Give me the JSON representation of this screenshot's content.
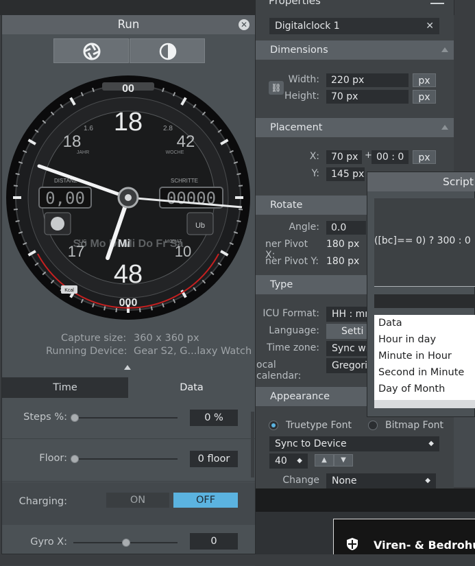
{
  "properties": {
    "title": "Properties",
    "name_value": "Digitalclock 1",
    "dimensions": {
      "header": "Dimensions",
      "width_label": "Width:",
      "width_value": "220 px",
      "height_label": "Height:",
      "height_value": "70 px",
      "unit": "px"
    },
    "placement": {
      "header": "Placement",
      "x_label": "X:",
      "x_value": "70 px",
      "x_offset": "00 : 0",
      "y_label": "Y:",
      "y_value": "145 px",
      "unit": "px",
      "plus": "+"
    },
    "rotate": {
      "header": "Rotate",
      "angle_label": "Angle:",
      "angle_value": "0.0",
      "pivot_x_label": "ner Pivot X:",
      "pivot_x_value": "180 px",
      "pivot_y_label": "ner Pivot Y:",
      "pivot_y_value": "180 px"
    },
    "type": {
      "header": "Type",
      "icu_label": "ICU Format:",
      "icu_value": "HH : mr",
      "language_label": "Language:",
      "language_value": "Setti",
      "timezone_label": "Time zone:",
      "timezone_value": "Sync wi",
      "calendar_label": "ocal calendar:",
      "calendar_value": "Gregori"
    },
    "appearance": {
      "header": "Appearance",
      "truetype": "Truetype Font",
      "bitmap": "Bitmap Font",
      "font_value": "Sync to Device",
      "size_value": "40",
      "changecase_label": "Change case:",
      "changecase_value": "None"
    }
  },
  "run": {
    "title": "Run",
    "capture_label": "Capture size:",
    "capture_value": "360 x 360 px",
    "device_label": "Running Device:",
    "device_value": "Gear S2, G...laxy Watch",
    "tabs": [
      "Time",
      "Data"
    ],
    "sliders": [
      {
        "label": "Steps %:",
        "value": "0 %",
        "level": 0
      },
      {
        "label": "Floor:",
        "value": "0 floor",
        "level": 0
      },
      {
        "label": "Gyro X:",
        "value": "0",
        "level": 0.5
      }
    ],
    "charging": {
      "label": "Charging:",
      "on": "ON",
      "off": "OFF"
    }
  },
  "watch": {
    "top_marker": "00",
    "bottom_marker": "000",
    "hour_top": "18",
    "minute_bottom": "48",
    "left_box": "0,00",
    "right_box": "00000",
    "distance_label": "DISTANZ",
    "steps_label": "SCHRITTE",
    "left_ring": [
      "18",
      "1.6",
      "JAHR"
    ],
    "right_ring": [
      "42",
      "2.8",
      "WOCHE"
    ],
    "left_low": [
      "17",
      "LIG"
    ],
    "right_low": [
      "10",
      "MONAT"
    ],
    "days": "So Mo Di Mi Do Fr Sa",
    "day_highlight": "Mi",
    "corner_text": "Ub",
    "bottom_badge": "Kcal"
  },
  "script": {
    "title": "Script",
    "expression": "([bc]== 0) ? 300 : 0",
    "items": [
      "Data",
      "Hour in day",
      "Minute in Hour",
      "Second in Minute",
      "Day of Month"
    ]
  },
  "notification": {
    "text": "Viren- & Bedrohu"
  }
}
